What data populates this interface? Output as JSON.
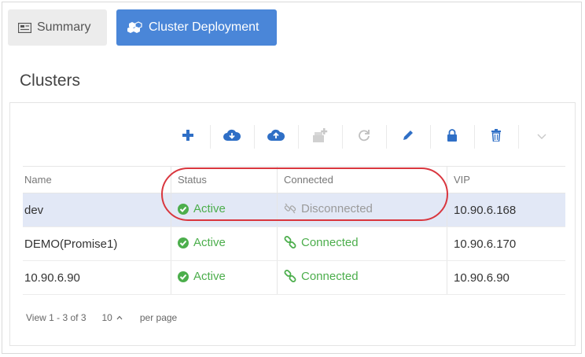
{
  "tabs": {
    "summary_label": "Summary",
    "cluster_label": "Cluster Deployment"
  },
  "section_title": "Clusters",
  "toolbar": {
    "icons": [
      "plus-icon",
      "cloud-download-icon",
      "cloud-upload-icon",
      "add-node-icon",
      "refresh-icon",
      "edit-icon",
      "lock-icon",
      "trash-icon",
      "chevron-down-icon"
    ]
  },
  "table": {
    "columns": [
      "Name",
      "Status",
      "Connected",
      "VIP"
    ],
    "rows": [
      {
        "name": "dev",
        "status": "Active",
        "connected": "Disconnected",
        "vip": "10.90.6.168"
      },
      {
        "name": "DEMO(Promise1)",
        "status": "Active",
        "connected": "Connected",
        "vip": "10.90.6.170"
      },
      {
        "name": "10.90.6.90",
        "status": "Active",
        "connected": "Connected",
        "vip": "10.90.6.90"
      }
    ]
  },
  "footer": {
    "view_text": "View 1 - 3 of 3",
    "page_size": "10",
    "per_page": "per page"
  },
  "colors": {
    "accent": "#4a86d8",
    "success": "#4cae4c",
    "selected_row": "#e2e8f6",
    "annotation": "#d9363e"
  }
}
